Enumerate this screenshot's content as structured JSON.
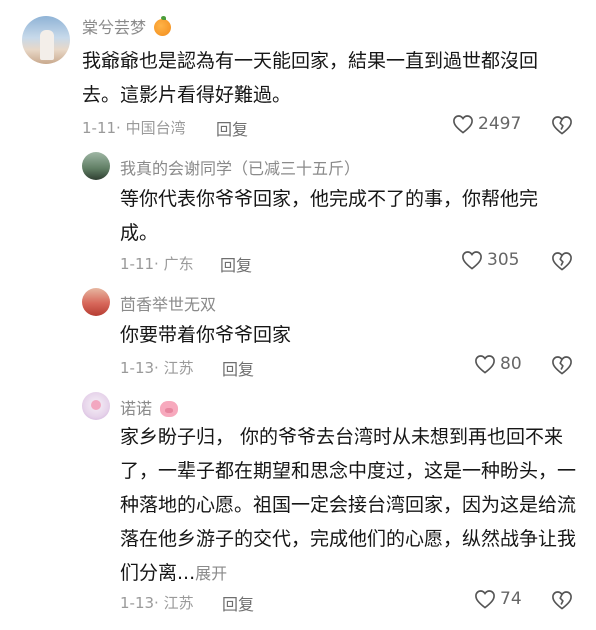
{
  "comments": [
    {
      "user": "棠兮芸梦",
      "text": "我爺爺也是認為有一天能回家，結果一直到過世都沒回去。這影片看得好難過。",
      "date": "1-11",
      "location": "中国台湾",
      "reply": "回复",
      "likes": "2497"
    },
    {
      "user": "我真的会谢同学（已减三十五斤）",
      "text": "等你代表你爷爷回家，他完成不了的事，你帮他完成。",
      "date": "1-11",
      "location": "广东",
      "reply": "回复",
      "likes": "305"
    },
    {
      "user": "茴香举世无双",
      "text": "你要带着你爷爷回家",
      "date": "1-13",
      "location": "江苏",
      "reply": "回复",
      "likes": "80"
    },
    {
      "user": "诺诺",
      "text": "家乡盼子归， 你的爷爷去台湾时从未想到再也回不来了，一辈子都在期望和思念中度过，这是一种盼头，一种落地的心愿。祖国一定会接台湾回家，因为这是给流落在他乡游子的交代，完成他们的心愿，纵然战争让我们分离...",
      "more": "展开",
      "date": "1-13",
      "location": "江苏",
      "reply": "回复",
      "likes": "74"
    }
  ],
  "separator": "·",
  "icons": {
    "emoji_orange": "orange-emoji",
    "emoji_pig": "pig-emoji",
    "like": "heart-outline",
    "dislike": "broken-heart-outline"
  }
}
